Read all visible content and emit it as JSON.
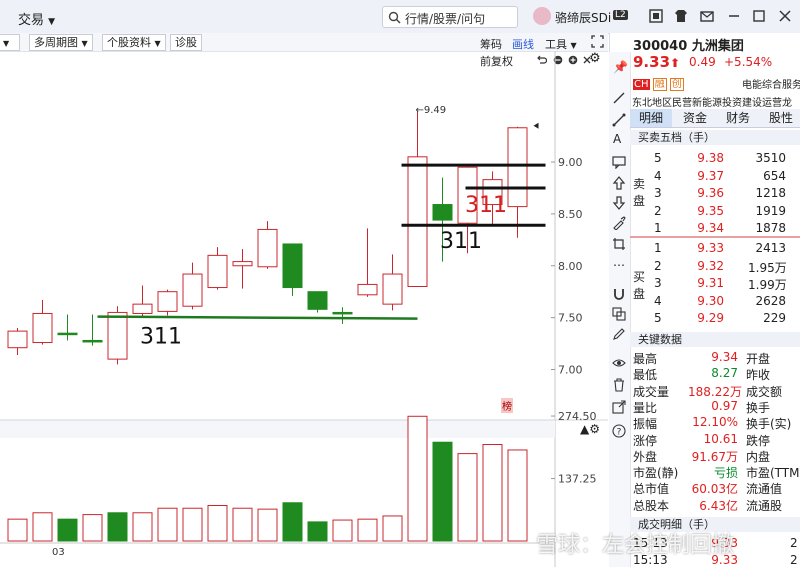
{
  "topbar": {
    "trade_menu": "交易",
    "search_placeholder": "行情/股票/问句",
    "username": "骆缔辰SDi",
    "level": "L2"
  },
  "toolbar": {
    "multi_period": "多周期图",
    "stock_info": "个股资料",
    "diagnose": "诊股",
    "chip": "筹码",
    "draw_line": "画线",
    "tools": "工具",
    "pre_adjust": "前复权"
  },
  "chart_data": [
    {
      "type": "candlestick",
      "title": "",
      "y_ticks": [
        "9.00",
        "8.50",
        "8.00",
        "7.50",
        "7.00"
      ],
      "ylim": [
        6.6,
        9.8
      ],
      "candles": [
        {
          "o": 7.21,
          "c": 7.37,
          "h": 7.4,
          "l": 7.14,
          "up": true
        },
        {
          "o": 7.26,
          "c": 7.54,
          "h": 7.67,
          "l": 7.24,
          "up": true
        },
        {
          "o": 7.35,
          "c": 7.35,
          "h": 7.53,
          "l": 7.28,
          "up": false
        },
        {
          "o": 7.28,
          "c": 7.28,
          "h": 7.53,
          "l": 7.23,
          "up": false
        },
        {
          "o": 7.1,
          "c": 7.55,
          "h": 7.61,
          "l": 7.05,
          "up": true
        },
        {
          "o": 7.54,
          "c": 7.63,
          "h": 7.81,
          "l": 7.51,
          "up": true
        },
        {
          "o": 7.56,
          "c": 7.75,
          "h": 7.77,
          "l": 7.52,
          "up": true
        },
        {
          "o": 7.61,
          "c": 7.92,
          "h": 8.03,
          "l": 7.58,
          "up": true
        },
        {
          "o": 7.79,
          "c": 8.1,
          "h": 8.18,
          "l": 7.77,
          "up": true
        },
        {
          "o": 8.0,
          "c": 8.04,
          "h": 8.16,
          "l": 7.78,
          "up": true
        },
        {
          "o": 7.99,
          "c": 8.35,
          "h": 8.43,
          "l": 7.97,
          "up": true
        },
        {
          "o": 8.21,
          "c": 7.79,
          "h": 8.21,
          "l": 7.71,
          "up": false
        },
        {
          "o": 7.75,
          "c": 7.58,
          "h": 7.75,
          "l": 7.55,
          "up": false
        },
        {
          "o": 7.55,
          "c": 7.55,
          "h": 7.6,
          "l": 7.44,
          "up": false
        },
        {
          "o": 7.72,
          "c": 7.82,
          "h": 8.36,
          "l": 7.7,
          "up": true
        },
        {
          "o": 7.63,
          "c": 7.92,
          "h": 8.11,
          "l": 7.57,
          "up": true
        },
        {
          "o": 7.8,
          "c": 9.05,
          "h": 9.49,
          "l": 7.8,
          "up": true
        },
        {
          "o": 8.59,
          "c": 8.44,
          "h": 8.85,
          "l": 8.04,
          "up": false
        },
        {
          "o": 8.41,
          "c": 8.95,
          "h": 8.97,
          "l": 8.12,
          "up": true
        },
        {
          "o": 8.59,
          "c": 8.83,
          "h": 8.91,
          "l": 8.4,
          "up": true
        },
        {
          "o": 8.57,
          "c": 9.33,
          "h": 9.34,
          "l": 8.27,
          "up": true
        }
      ],
      "high_annotation": "←9.49",
      "support_label": "311",
      "resistance_label_red": "311",
      "resistance_label_black": "311",
      "side_badge": "榜"
    },
    {
      "type": "bar",
      "title": "",
      "y_ticks": [
        "274.50",
        "137.25"
      ],
      "ylim": [
        0,
        290
      ],
      "x_tick": "03",
      "values": [
        48,
        62,
        48,
        58,
        62,
        62,
        72,
        72,
        78,
        72,
        70,
        84,
        42,
        46,
        48,
        55,
        274,
        217,
        192,
        212,
        200
      ],
      "up": [
        true,
        true,
        false,
        true,
        false,
        true,
        true,
        true,
        true,
        true,
        true,
        false,
        false,
        true,
        true,
        true,
        true,
        false,
        true,
        true,
        true
      ]
    }
  ],
  "quote": {
    "code": "300040",
    "name": "九洲集团",
    "price": "9.33",
    "change": "0.49",
    "change_pct": "+5.54%",
    "badges": [
      "CH",
      "融",
      "创"
    ],
    "industry": "电能综合服务",
    "region": "东北地区民营新能源投资建设运营龙",
    "tabs": [
      "明细",
      "资金",
      "财务",
      "股性"
    ],
    "order_book_title": "买卖五档（手）",
    "sell_label": "卖盘",
    "buy_label": "买盘",
    "asks": [
      {
        "lvl": "5",
        "price": "9.38",
        "vol": "3510"
      },
      {
        "lvl": "4",
        "price": "9.37",
        "vol": "654"
      },
      {
        "lvl": "3",
        "price": "9.36",
        "vol": "1218"
      },
      {
        "lvl": "2",
        "price": "9.35",
        "vol": "1919"
      },
      {
        "lvl": "1",
        "price": "9.34",
        "vol": "1878"
      }
    ],
    "bids": [
      {
        "lvl": "1",
        "price": "9.33",
        "vol": "2413"
      },
      {
        "lvl": "2",
        "price": "9.32",
        "vol": "1.95万"
      },
      {
        "lvl": "3",
        "price": "9.31",
        "vol": "1.99万"
      },
      {
        "lvl": "4",
        "price": "9.30",
        "vol": "2628"
      },
      {
        "lvl": "5",
        "price": "9.29",
        "vol": "229"
      }
    ],
    "key_data_title": "关键数据",
    "key_data": [
      {
        "k1": "最高",
        "v1": "9.34",
        "k2": "开盘"
      },
      {
        "k1": "最低",
        "v1": "8.27",
        "k2": "昨收"
      },
      {
        "k1": "成交量",
        "v1": "188.22万",
        "k2": "成交额"
      },
      {
        "k1": "量比",
        "v1": "0.97",
        "k2": "换手"
      },
      {
        "k1": "振幅",
        "v1": "12.10%",
        "k2": "换手(实)"
      },
      {
        "k1": "涨停",
        "v1": "10.61",
        "k2": "跌停"
      },
      {
        "k1": "外盘",
        "v1": "91.67万",
        "k2": "内盘"
      },
      {
        "k1": "市盈(静)",
        "v1": "亏损",
        "k2": "市盈(TTM"
      },
      {
        "k1": "总市值",
        "v1": "60.03亿",
        "k2": "流通值"
      },
      {
        "k1": "总股本",
        "v1": "6.43亿",
        "k2": "流通股"
      }
    ],
    "trades_title": "成交明细（手）",
    "trades": [
      {
        "time": "15:13",
        "price": "9.33",
        "vol": "2"
      },
      {
        "time": "15:13",
        "price": "9.33",
        "vol": "2"
      }
    ]
  },
  "watermark": "雪球：左会控制回撤"
}
